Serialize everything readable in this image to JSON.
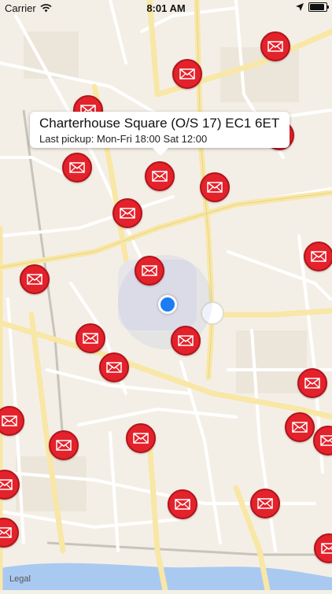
{
  "status_bar": {
    "carrier": "Carrier",
    "time": "8:01 AM"
  },
  "callout": {
    "title": "Charterhouse Square (O/S 17)  EC1 6ET",
    "subtitle": "Last pickup: Mon-Fri 18:00 Sat 12:00"
  },
  "map": {
    "legal_link": "Legal"
  },
  "colors": {
    "marker": "#e4222b",
    "user_location": "#1b7cf3",
    "water": "#a9c9f1",
    "map_bg": "#f4efe6"
  },
  "icons": {
    "marker": "envelope-icon",
    "wifi": "wifi-icon",
    "location": "location-arrow-icon",
    "battery": "battery-icon"
  }
}
